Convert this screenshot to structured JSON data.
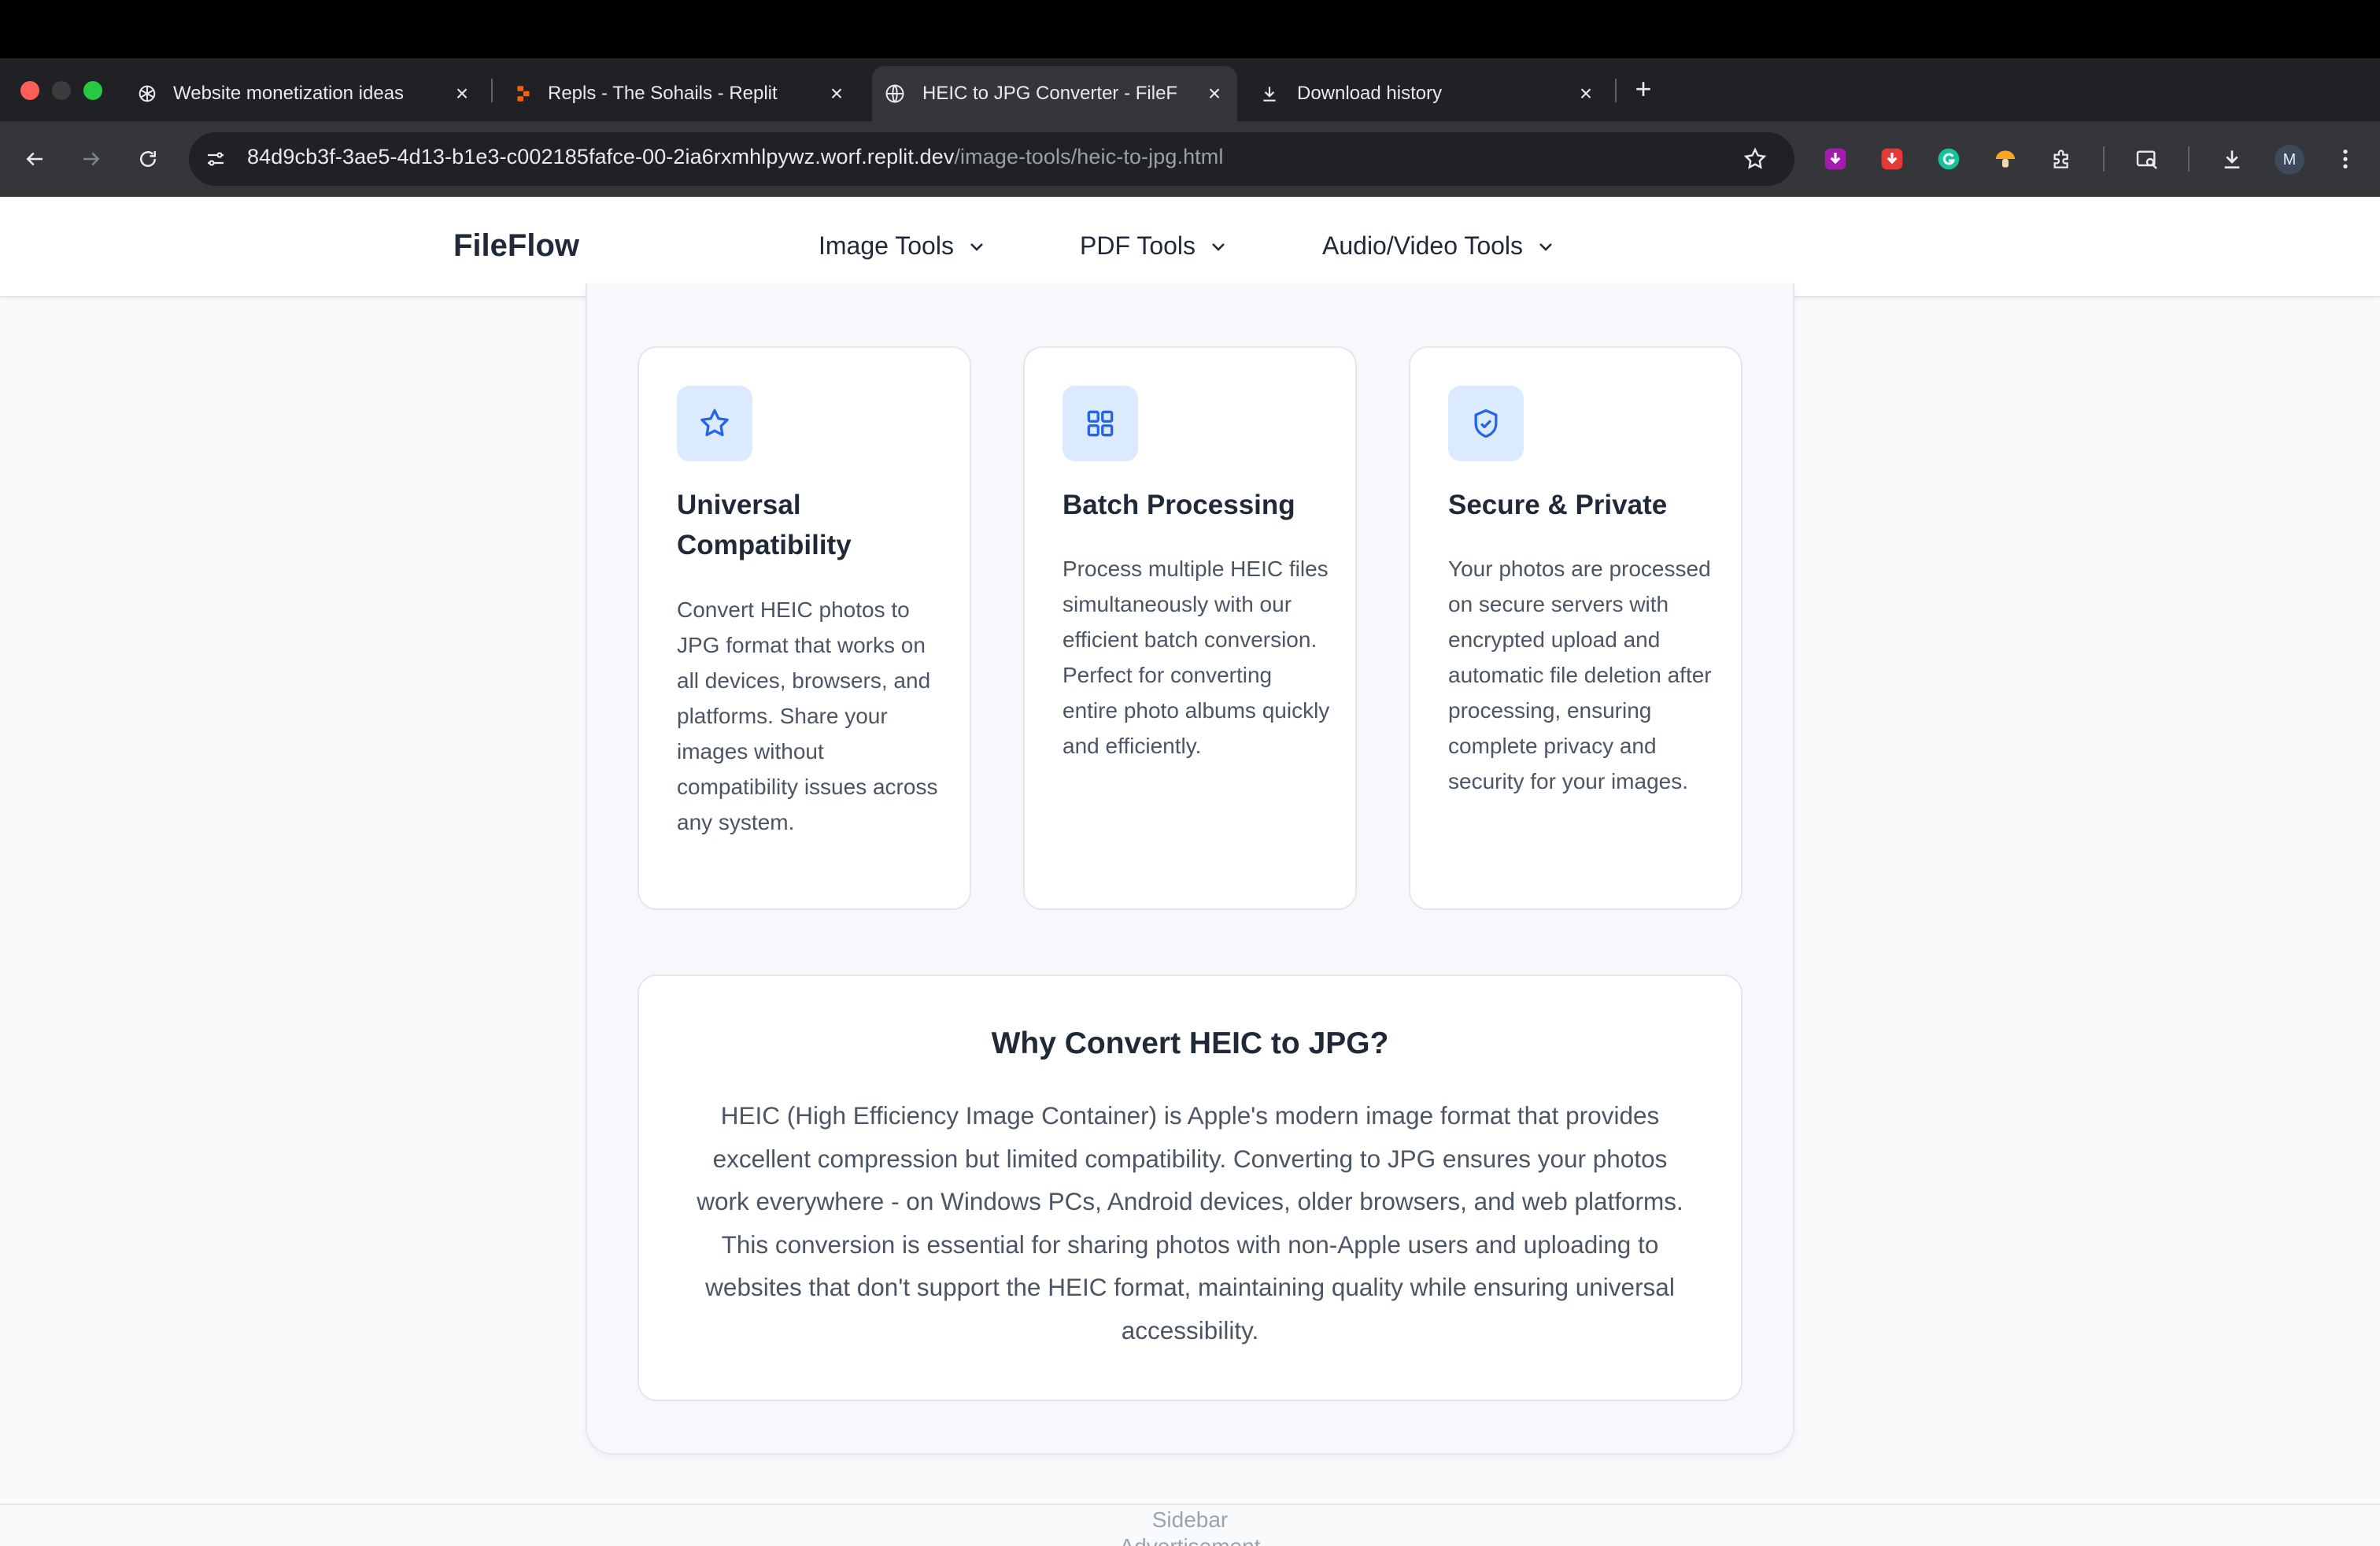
{
  "browser": {
    "tabs": [
      {
        "title": "Website monetization ideas",
        "favicon": "openai-icon",
        "active": false
      },
      {
        "title": "Repls - The Sohails - Replit",
        "favicon": "replit-icon",
        "active": false
      },
      {
        "title": "HEIC to JPG Converter - FileF",
        "favicon": "globe-icon",
        "active": true
      },
      {
        "title": "Download history",
        "favicon": "download-icon",
        "active": false
      }
    ],
    "url_host": "84d9cb3f-3ae5-4d13-b1e3-c002185fafce-00-2ia6rxmhlpywz.worf.replit.dev",
    "url_path": "/image-tools/heic-to-jpg.html",
    "avatar_letter": "M",
    "colors": {
      "tabstrip": "#202124",
      "toolbar": "#35363a"
    }
  },
  "site": {
    "logo": "FileFlow",
    "nav": [
      {
        "label": "Image Tools"
      },
      {
        "label": "PDF Tools"
      },
      {
        "label": "Audio/Video Tools"
      }
    ]
  },
  "features": [
    {
      "icon": "star-icon",
      "title": "Universal Compatibility",
      "description": "Convert HEIC photos to JPG format that works on all devices, browsers, and platforms. Share your images without compatibility issues across any system."
    },
    {
      "icon": "grid-icon",
      "title": "Batch Processing",
      "description": "Process multiple HEIC files simultaneously with our efficient batch conversion. Perfect for converting entire photo albums quickly and efficiently."
    },
    {
      "icon": "shield-check-icon",
      "title": "Secure & Private",
      "description": "Your photos are processed on secure servers with encrypted upload and automatic file deletion after processing, ensuring complete privacy and security for your images."
    }
  ],
  "why": {
    "title": "Why Convert HEIC to JPG?",
    "body": "HEIC (High Efficiency Image Container) is Apple's modern image format that provides excellent compression but limited compatibility. Converting to JPG ensures your photos work everywhere - on Windows PCs, Android devices, older browsers, and web platforms. This conversion is essential for sharing photos with non-Apple users and uploading to websites that don't support the HEIC format, maintaining quality while ensuring universal accessibility."
  },
  "ad": {
    "line1": "Sidebar",
    "line2": "Advertisement"
  },
  "theme": {
    "accent": "#2563eb",
    "icon_bg": "#dbeafe",
    "text_primary": "#1f2937",
    "text_secondary": "#4b5563"
  }
}
